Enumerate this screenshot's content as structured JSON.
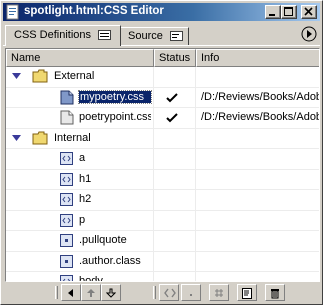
{
  "window": {
    "title": "spotlight.html:CSS Editor"
  },
  "tabs": [
    {
      "label": "CSS Definitions",
      "active": true
    },
    {
      "label": "Source",
      "active": false
    }
  ],
  "columns": {
    "name": "Name",
    "status": "Status",
    "info": "Info"
  },
  "groups": [
    {
      "label": "External",
      "items": [
        {
          "name": "mypoetry.css",
          "status": "ok",
          "info": "/D:/Reviews/Books/Adobe",
          "selected": true,
          "icon": "stylesheet-file-icon"
        },
        {
          "name": "poetrypoint.css",
          "status": "ok",
          "info": "/D:/Reviews/Books/Adobe",
          "selected": false,
          "icon": "stylesheet-file-icon"
        }
      ]
    },
    {
      "label": "Internal",
      "items": [
        {
          "name": "a",
          "icon": "tag-rule-icon"
        },
        {
          "name": "h1",
          "icon": "tag-rule-icon"
        },
        {
          "name": "h2",
          "icon": "tag-rule-icon"
        },
        {
          "name": "p",
          "icon": "tag-rule-icon"
        },
        {
          "name": ".pullquote",
          "icon": "class-rule-icon"
        },
        {
          "name": ".author.class",
          "icon": "class-rule-icon"
        },
        {
          "name": "body",
          "icon": "tag-rule-icon"
        }
      ]
    }
  ],
  "colors": {
    "title_bar": "#0a246a",
    "selection": "#0a246a",
    "window_bg": "#d4d0c8"
  }
}
